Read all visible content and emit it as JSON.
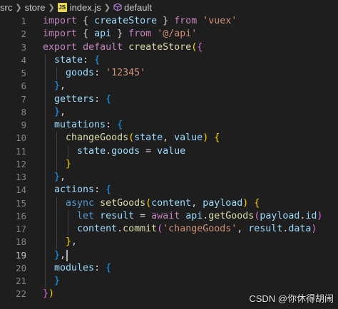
{
  "breadcrumb": {
    "items": [
      "src",
      "store",
      "index.js",
      "default"
    ],
    "file_icon_label": "JS"
  },
  "editor": {
    "active_line": 19,
    "lines": [
      {
        "n": "1",
        "tokens": [
          [
            "import",
            "kw"
          ],
          [
            " { ",
            "punc"
          ],
          [
            "createStore",
            "var"
          ],
          [
            " } ",
            "punc"
          ],
          [
            "from",
            "kw"
          ],
          [
            " ",
            "punc"
          ],
          [
            "'vuex'",
            "str"
          ]
        ]
      },
      {
        "n": "2",
        "tokens": [
          [
            "import",
            "kw"
          ],
          [
            " { ",
            "punc"
          ],
          [
            "api",
            "var"
          ],
          [
            " } ",
            "punc"
          ],
          [
            "from",
            "kw"
          ],
          [
            " ",
            "punc"
          ],
          [
            "'@/api'",
            "str"
          ]
        ]
      },
      {
        "n": "3",
        "tokens": [
          [
            "export",
            "kw"
          ],
          [
            " ",
            "punc"
          ],
          [
            "default",
            "kw"
          ],
          [
            " ",
            "punc"
          ],
          [
            "createStore",
            "fn"
          ],
          [
            "(",
            "b1"
          ],
          [
            "{",
            "b2"
          ]
        ]
      },
      {
        "n": "4",
        "tokens": [
          [
            "  ",
            "punc"
          ],
          [
            "state",
            "var"
          ],
          [
            ": ",
            "punc"
          ],
          [
            "{",
            "b3"
          ]
        ]
      },
      {
        "n": "5",
        "tokens": [
          [
            "    ",
            "punc"
          ],
          [
            "goods",
            "var"
          ],
          [
            ": ",
            "punc"
          ],
          [
            "'12345'",
            "str"
          ]
        ]
      },
      {
        "n": "6",
        "tokens": [
          [
            "  ",
            "punc"
          ],
          [
            "}",
            "b3"
          ],
          [
            ",",
            "punc"
          ]
        ]
      },
      {
        "n": "7",
        "tokens": [
          [
            "  ",
            "punc"
          ],
          [
            "getters",
            "var"
          ],
          [
            ": ",
            "punc"
          ],
          [
            "{",
            "b3"
          ]
        ]
      },
      {
        "n": "8",
        "tokens": [
          [
            "  ",
            "punc"
          ],
          [
            "}",
            "b3"
          ],
          [
            ",",
            "punc"
          ]
        ]
      },
      {
        "n": "9",
        "tokens": [
          [
            "  ",
            "punc"
          ],
          [
            "mutations",
            "var"
          ],
          [
            ": ",
            "punc"
          ],
          [
            "{",
            "b3"
          ]
        ]
      },
      {
        "n": "10",
        "tokens": [
          [
            "    ",
            "punc"
          ],
          [
            "changeGoods",
            "fn"
          ],
          [
            "(",
            "b1"
          ],
          [
            "state",
            "var"
          ],
          [
            ", ",
            "punc"
          ],
          [
            "value",
            "var"
          ],
          [
            ")",
            "b1"
          ],
          [
            " ",
            "punc"
          ],
          [
            "{",
            "b1"
          ]
        ]
      },
      {
        "n": "11",
        "tokens": [
          [
            "      ",
            "punc"
          ],
          [
            "state",
            "var"
          ],
          [
            ".",
            "punc"
          ],
          [
            "goods",
            "var"
          ],
          [
            " = ",
            "punc"
          ],
          [
            "value",
            "var"
          ]
        ]
      },
      {
        "n": "12",
        "tokens": [
          [
            "    ",
            "punc"
          ],
          [
            "}",
            "b1"
          ]
        ]
      },
      {
        "n": "13",
        "tokens": [
          [
            "  ",
            "punc"
          ],
          [
            "}",
            "b3"
          ],
          [
            ",",
            "punc"
          ]
        ]
      },
      {
        "n": "14",
        "tokens": [
          [
            "  ",
            "punc"
          ],
          [
            "actions",
            "var"
          ],
          [
            ": ",
            "punc"
          ],
          [
            "{",
            "b3"
          ]
        ]
      },
      {
        "n": "15",
        "tokens": [
          [
            "    ",
            "punc"
          ],
          [
            "async",
            "kwb"
          ],
          [
            " ",
            "punc"
          ],
          [
            "setGoods",
            "fn"
          ],
          [
            "(",
            "b1"
          ],
          [
            "content",
            "var"
          ],
          [
            ", ",
            "punc"
          ],
          [
            "payload",
            "var"
          ],
          [
            ")",
            "b1"
          ],
          [
            " ",
            "punc"
          ],
          [
            "{",
            "b1"
          ]
        ]
      },
      {
        "n": "16",
        "tokens": [
          [
            "      ",
            "punc"
          ],
          [
            "let",
            "kwb"
          ],
          [
            " ",
            "punc"
          ],
          [
            "result",
            "var"
          ],
          [
            " = ",
            "punc"
          ],
          [
            "await",
            "kw"
          ],
          [
            " ",
            "punc"
          ],
          [
            "api",
            "var"
          ],
          [
            ".",
            "punc"
          ],
          [
            "getGoods",
            "fn"
          ],
          [
            "(",
            "b2"
          ],
          [
            "payload",
            "var"
          ],
          [
            ".",
            "punc"
          ],
          [
            "id",
            "var"
          ],
          [
            ")",
            "b2"
          ]
        ]
      },
      {
        "n": "17",
        "tokens": [
          [
            "      ",
            "punc"
          ],
          [
            "content",
            "var"
          ],
          [
            ".",
            "punc"
          ],
          [
            "commit",
            "fn"
          ],
          [
            "(",
            "b2"
          ],
          [
            "'changeGoods'",
            "str"
          ],
          [
            ", ",
            "punc"
          ],
          [
            "result",
            "var"
          ],
          [
            ".",
            "punc"
          ],
          [
            "data",
            "var"
          ],
          [
            ")",
            "b2"
          ]
        ]
      },
      {
        "n": "18",
        "tokens": [
          [
            "    ",
            "punc"
          ],
          [
            "}",
            "b1"
          ],
          [
            ",",
            "punc"
          ]
        ]
      },
      {
        "n": "19",
        "tokens": [
          [
            "  ",
            "punc"
          ],
          [
            "}",
            "b3"
          ],
          [
            ",",
            "punc"
          ]
        ]
      },
      {
        "n": "20",
        "tokens": [
          [
            "  ",
            "punc"
          ],
          [
            "modules",
            "var"
          ],
          [
            ": ",
            "punc"
          ],
          [
            "{",
            "b3"
          ]
        ]
      },
      {
        "n": "21",
        "tokens": [
          [
            "  ",
            "punc"
          ],
          [
            "}",
            "b3"
          ]
        ]
      },
      {
        "n": "22",
        "tokens": [
          [
            "}",
            "b2"
          ],
          [
            ")",
            "b1"
          ]
        ]
      }
    ]
  },
  "watermark": "CSDN @你休得胡闹",
  "colors": {
    "background": "#1e1e1e",
    "keyword": "#c586c0",
    "variable": "#9cdcfe",
    "function": "#dcdcaa",
    "string": "#ce9178"
  }
}
